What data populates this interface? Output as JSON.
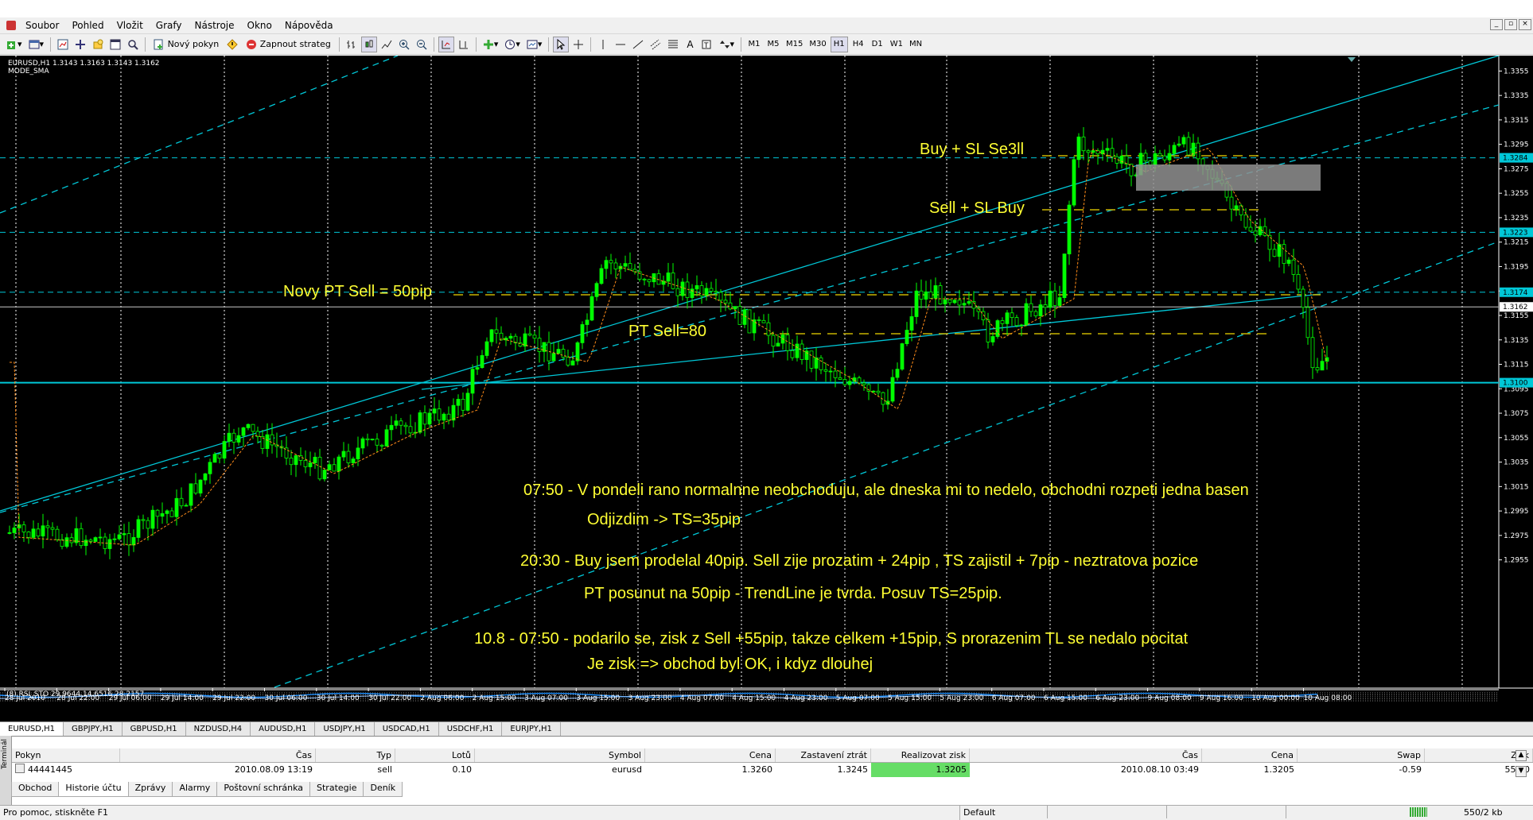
{
  "menu": [
    "Soubor",
    "Pohled",
    "Vložit",
    "Grafy",
    "Nástroje",
    "Okno",
    "Nápověda"
  ],
  "toolbar": {
    "new_order": "Nový pokyn",
    "autotrade": "Zapnout strateg",
    "timeframes": [
      "M1",
      "M5",
      "M15",
      "M30",
      "H1",
      "H4",
      "D1",
      "W1",
      "MN"
    ],
    "active_timeframe": "H1"
  },
  "chart": {
    "symbol_line": "EURUSD,H1  1.3143 1.3163 1.3143 1.3162",
    "indicator_line": "MODE_SMA",
    "subwindow_label": "(8) RSI_STO 29.9644 14.6516 28.2157",
    "price_tags": [
      {
        "label": "1.3284",
        "price": 1.3284
      },
      {
        "label": "1.3223",
        "price": 1.3223
      },
      {
        "label": "1.3174",
        "price": 1.3174
      },
      {
        "label": "1.3162",
        "price": 1.3162
      },
      {
        "label": "1.3100",
        "price": 1.31
      }
    ],
    "price_axis": [
      "1.3355",
      "1.3335",
      "1.3315",
      "1.3295",
      "1.3275",
      "1.3255",
      "1.3235",
      "1.3215",
      "1.3195",
      "1.3175",
      "1.3155",
      "1.3135",
      "1.3115",
      "1.3095",
      "1.3075",
      "1.3055",
      "1.3035",
      "1.3015",
      "1.2995",
      "1.2975",
      "1.2955"
    ],
    "time_axis": [
      "28 Jul 2010",
      "28 Jul 22:00",
      "29 Jul 06:00",
      "29 Jul 14:00",
      "29 Jul 22:00",
      "30 Jul 06:00",
      "30 Jul 14:00",
      "30 Jul 22:00",
      "2 Aug 06:00",
      "2 Aug 15:00",
      "3 Aug 07:00",
      "3 Aug 15:00",
      "3 Aug 23:00",
      "4 Aug 07:00",
      "4 Aug 15:00",
      "4 Aug 23:00",
      "5 Aug 07:00",
      "5 Aug 15:00",
      "5 Aug 23:00",
      "6 Aug 07:00",
      "6 Aug 15:00",
      "6 Aug 23:00",
      "9 Aug 08:00",
      "9 Aug 16:00",
      "10 Aug 00:00",
      "10 Aug 08:00"
    ],
    "annotations": {
      "buy_sl_sell": "Buy + SL Se3ll",
      "sell_sl_buy": "Sell + SL Buy",
      "novy_pt": "Novy PT Sell = 50pip",
      "pt_sell": "PT Sell=80",
      "note1": "07:50 - V pondeli rano normalnne neobchoduju, ale dneska mi to nedelo, obchodni rozpeti jedna basen",
      "note2": "Odjizdim -> TS=35pip",
      "note3": "20:30 - Buy jsem prodelal 40pip. Sell zije prozatim + 24pip , TS zajistil + 7pip - neztratova pozice",
      "note4": "PT posunut na 50pip - TrendLine je tvrda.   Posuv TS=25pip.",
      "note5": "10.8 - 07:50 - podarilo se, zisk z Sell +55pip, takze celkem  +15pip, S prorazenim TL se nedalo pocitat",
      "note6": "Je zisk => obchod byl OK, i kdyz dlouhej"
    }
  },
  "symbol_tabs": [
    "EURUSD,H1",
    "GBPJPY,H1",
    "GBPUSD,H1",
    "NZDUSD,H4",
    "AUDUSD,H1",
    "USDJPY,H1",
    "USDCAD,H1",
    "USDCHF,H1",
    "EURJPY,H1"
  ],
  "terminal": {
    "headers": [
      "Pokyn",
      "Čas",
      "Typ",
      "Lotů",
      "Symbol",
      "Cena",
      "Zastavení ztrát",
      "Realizovat zisk",
      "Čas",
      "Cena",
      "Swap",
      "Zisk"
    ],
    "row": [
      "44441445",
      "2010.08.09 13:19",
      "sell",
      "0.10",
      "eurusd",
      "1.3260",
      "1.3245",
      "1.3205",
      "2010.08.10 03:49",
      "1.3205",
      "-0.59",
      "55.00"
    ],
    "tabs": [
      "Obchod",
      "Historie účtu",
      "Zprávy",
      "Alarmy",
      "Poštovní schránka",
      "Strategie",
      "Deník"
    ],
    "active_tab": "Historie účtu",
    "side_label": "Terminál"
  },
  "status": {
    "help": "Pro pomoc, stiskněte F1",
    "profile": "Default",
    "traffic": "550/2 kb"
  },
  "colors": {
    "bull": "#00ff00",
    "bear": "#000000",
    "grid": "#ffffff",
    "channel": "#00c8d8",
    "level": "#c8b400",
    "ma": "#ff8c1a",
    "annotation": "#ffff33"
  }
}
